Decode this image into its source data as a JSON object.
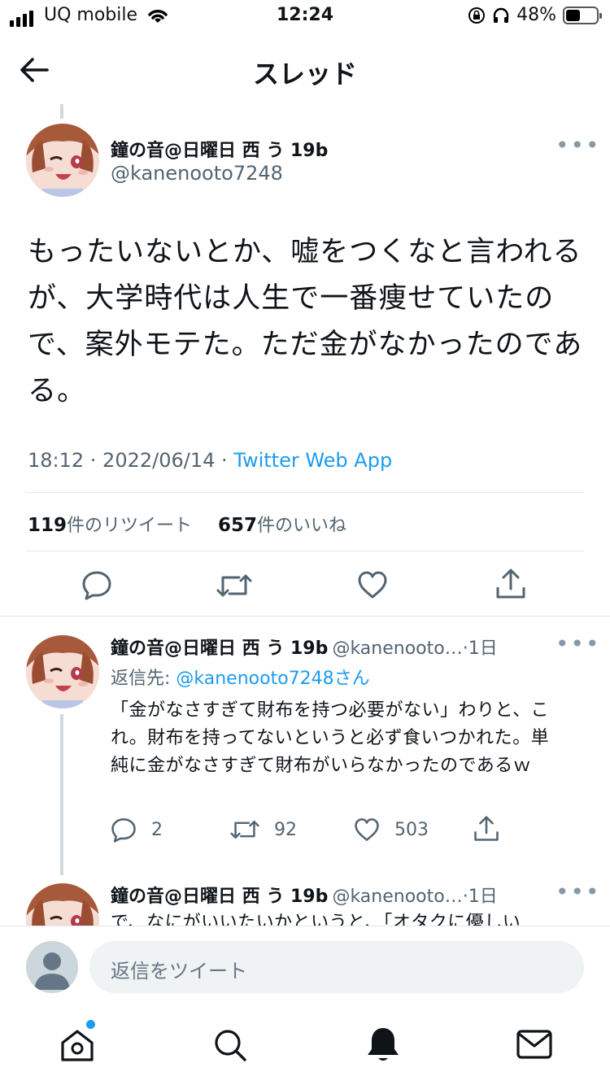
{
  "status_bar": {
    "carrier": "UQ mobile",
    "time": "12:24",
    "battery_percent": "48%",
    "battery_level": 0.48
  },
  "header": {
    "title": "スレッド"
  },
  "main_tweet": {
    "author_name": "鐘の音@日曜日 西 う 19b",
    "author_handle": "@kanenooto7248",
    "text": "もったいないとか、嘘をつくなと言われるが、大学時代は人生で一番痩せていたので、案外モテた。ただ金がなかったのである。",
    "timestamp": "18:12 · 2022/06/14 · ",
    "via": "Twitter Web App",
    "retweet_count": "119",
    "retweet_label": "件のリツイート",
    "like_count": "657",
    "like_label": "件のいいね"
  },
  "replies": [
    {
      "author_name": "鐘の音@日曜日 西 う 19b",
      "author_handle": "@kanenooto…",
      "time_ago": "·1日",
      "reply_prefix": "返信先: ",
      "reply_target": "@kanenooto7248さん",
      "text": "「金がなさすぎて財布を持つ必要がない」わりと、これ。財布を持ってないというと必ず食いつかれた。単純に金がなさすぎて財布がいらなかったのであるｗ",
      "reply_count": "2",
      "retweet_count": "92",
      "like_count": "503"
    },
    {
      "author_name": "鐘の音@日曜日 西 う 19b",
      "author_handle": "@kanenooto…",
      "time_ago": "·1日",
      "text": "で、なにがいいたいかというと、「オタクに優しい"
    }
  ],
  "composer": {
    "placeholder": "返信をツイート"
  },
  "tabbar": {
    "items": [
      "home-icon",
      "search-icon",
      "notifications-icon",
      "messages-icon"
    ]
  },
  "colors": {
    "accent": "#1d9bf0",
    "muted": "#536471",
    "divider": "#e1e8ed"
  }
}
